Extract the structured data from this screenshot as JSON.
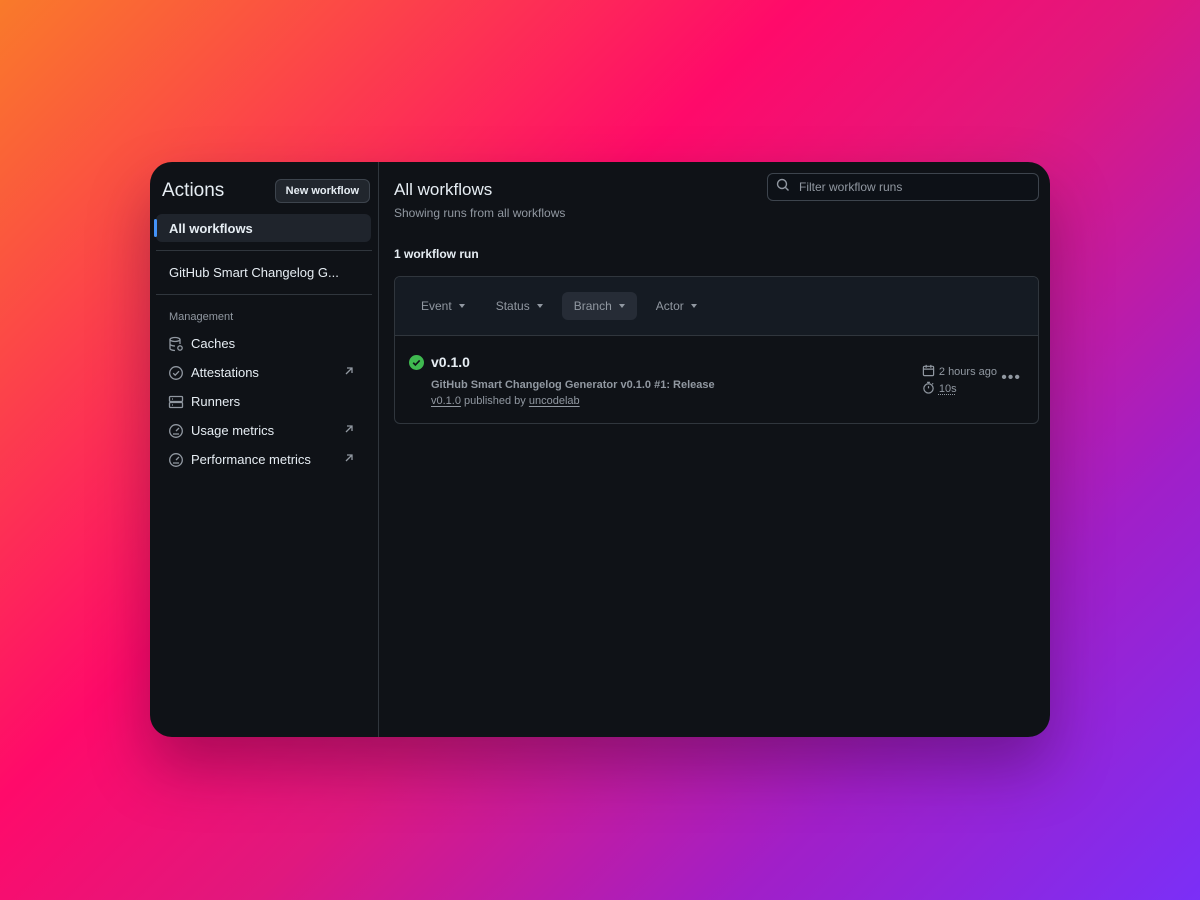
{
  "sidebar": {
    "title": "Actions",
    "new_workflow_label": "New workflow",
    "all_workflows_label": "All workflows",
    "workflow_item": "GitHub Smart Changelog G...",
    "management_heading": "Management",
    "management_items": [
      {
        "label": "Caches",
        "icon": "database-icon",
        "external": false
      },
      {
        "label": "Attestations",
        "icon": "check-circle-icon",
        "external": true
      },
      {
        "label": "Runners",
        "icon": "server-icon",
        "external": false
      },
      {
        "label": "Usage metrics",
        "icon": "meter-icon",
        "external": true
      },
      {
        "label": "Performance metrics",
        "icon": "meter-icon",
        "external": true
      }
    ]
  },
  "main": {
    "title": "All workflows",
    "subtitle": "Showing runs from all workflows",
    "filter_placeholder": "Filter workflow runs",
    "run_count": "1 workflow run",
    "filters": [
      {
        "label": "Event",
        "active": false
      },
      {
        "label": "Status",
        "active": false
      },
      {
        "label": "Branch",
        "active": true
      },
      {
        "label": "Actor",
        "active": false
      }
    ],
    "run": {
      "status": "success",
      "title": "v0.1.0",
      "description": "GitHub Smart Changelog Generator v0.1.0 #1: Release",
      "tag": "v0.1.0",
      "published_by_text": "published by",
      "author": "uncodelab",
      "time_ago": "2 hours ago",
      "duration": "10s"
    }
  },
  "colors": {
    "success": "#3fb950",
    "accent": "#4493f8",
    "background": "#0f1217"
  }
}
